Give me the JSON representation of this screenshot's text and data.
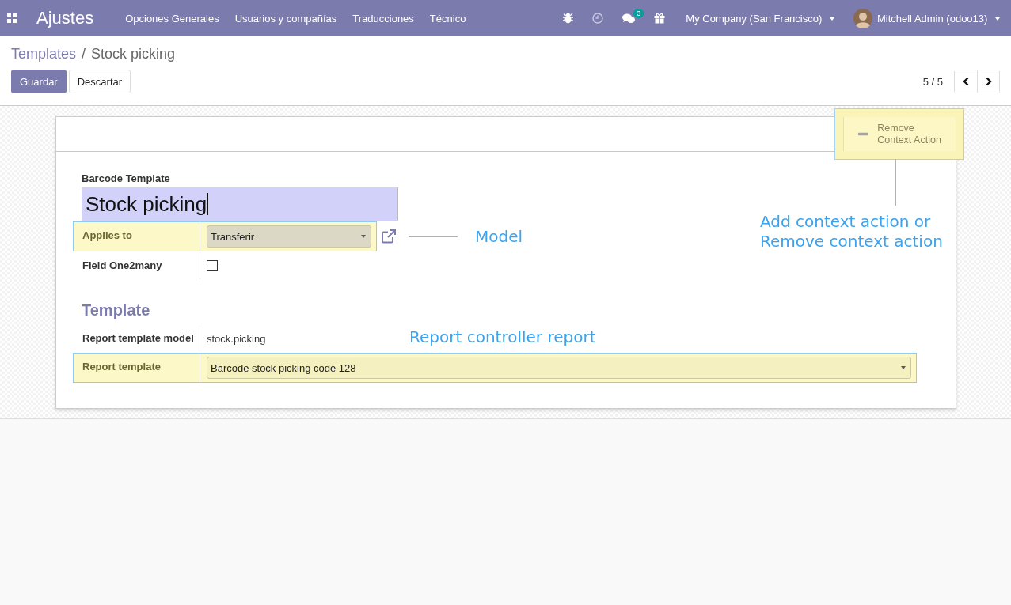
{
  "navbar": {
    "app_title": "Ajustes",
    "menu_items": [
      "Opciones Generales",
      "Usuarios y compañías",
      "Traducciones",
      "Técnico"
    ],
    "message_count": "3",
    "company": "My Company (San Francisco)",
    "user": "Mitchell Admin (odoo13)"
  },
  "breadcrumb": {
    "parent": "Templates",
    "separator": "/",
    "current": "Stock picking"
  },
  "buttons": [
    {
      "label": "Guardar",
      "kind": "primary"
    },
    {
      "label": "Descartar",
      "kind": "secondary"
    }
  ],
  "pager": {
    "value": "5 / 5"
  },
  "form": {
    "action_button": {
      "label": "Remove Context Action",
      "highlighted": true
    },
    "title_label": "Barcode Template",
    "title_value": "Stock picking",
    "fields": [
      {
        "label": "Applies to",
        "kind": "select",
        "value": "Transferir",
        "highlighted": true
      },
      {
        "label": "Field One2many",
        "kind": "checkbox",
        "checked": false,
        "highlighted": false
      }
    ],
    "section_title": "Template",
    "template_fields": [
      {
        "label": "Report template model",
        "kind": "text",
        "value": "stock.picking",
        "highlighted": false
      },
      {
        "label": "Report template",
        "kind": "select",
        "value": "Barcode stock picking code 128",
        "highlighted": true
      }
    ]
  },
  "annotations": {
    "model": "Model",
    "context_action": [
      "Add context action or",
      "Remove context action"
    ],
    "report": "Report controller report"
  }
}
